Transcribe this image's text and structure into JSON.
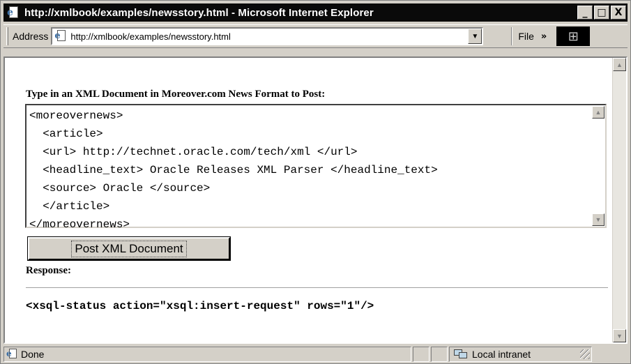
{
  "window": {
    "title": "http://xmlbook/examples/newsstory.html - Microsoft Internet Explorer",
    "buttons": {
      "minimize": "_",
      "maximize": "□",
      "close": "X"
    }
  },
  "addressbar": {
    "label": "Address",
    "url": "http://xmlbook/examples/newsstory.html",
    "menu_file": "File",
    "more": "»"
  },
  "page": {
    "prompt": "Type in an XML Document in Moreover.com News Format to Post:",
    "xml_document": "<moreovernews>\n  <article>\n  <url> http://technet.oracle.com/tech/xml </url>\n  <headline_text> Oracle Releases XML Parser </headline_text>\n  <source> Oracle </source>\n  </article>\n</moreovernews>",
    "post_button": "Post XML Document",
    "response_label": "Response:",
    "response_text": "<xsql-status action=\"xsql:insert-request\" rows=\"1\"/>"
  },
  "statusbar": {
    "status": "Done",
    "zone": "Local intranet"
  },
  "colors": {
    "chrome": "#d4d0c8",
    "titlebar": "#0a0a0a",
    "content_bg": "#ffffff"
  }
}
